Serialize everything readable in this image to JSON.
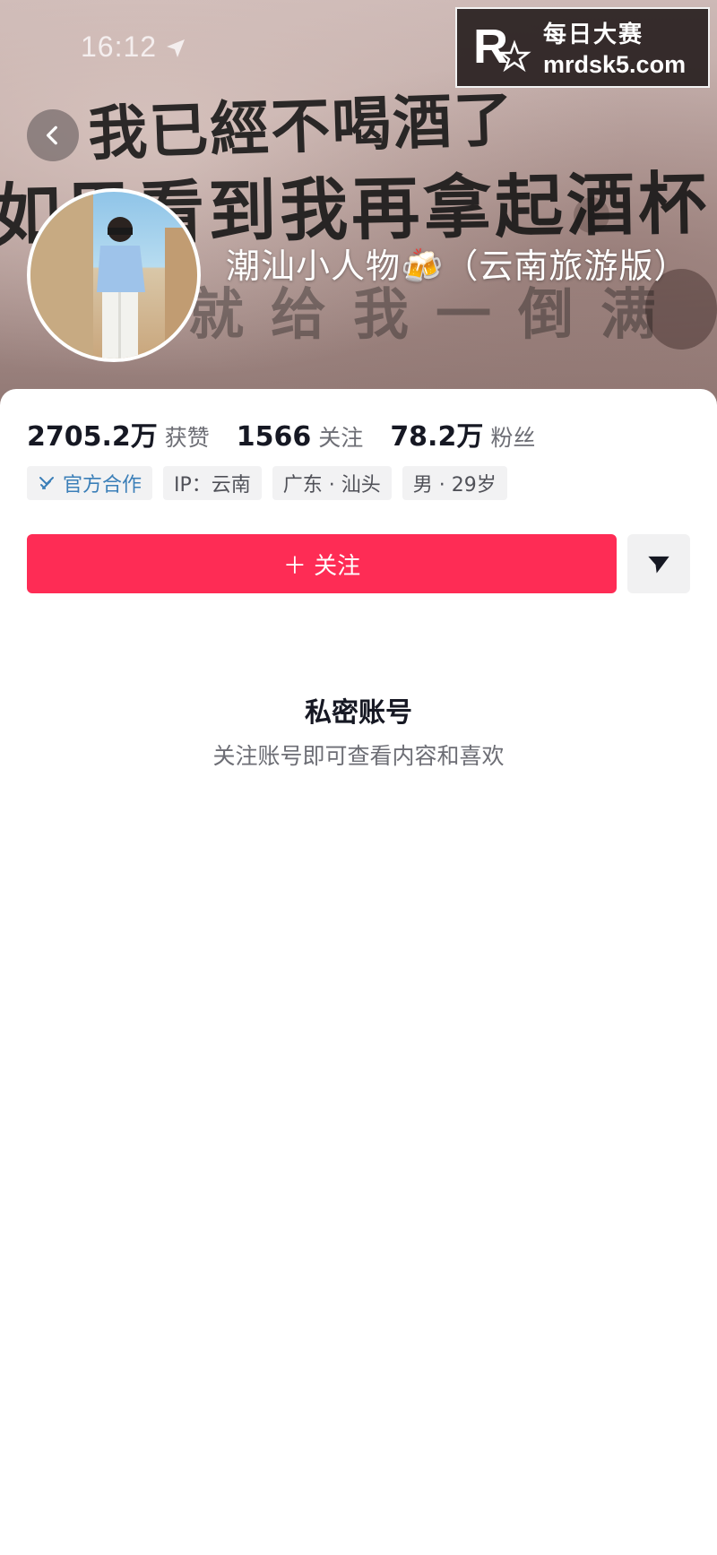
{
  "status_bar": {
    "time": "16:12"
  },
  "banner": {
    "scrawl_line1": "我已經不喝酒了",
    "scrawl_line2": "如果看到我再拿起酒杯",
    "scrawl_line3": "就给我一倒满"
  },
  "watermark": {
    "brand_cn": "每日大赛",
    "domain": "mrdsk5.com"
  },
  "profile": {
    "username": "潮汕小人物🍻（云南旅游版）",
    "stats": [
      {
        "value": "2705.2万",
        "label": "获赞"
      },
      {
        "value": "1566",
        "label": "关注"
      },
      {
        "value": "78.2万",
        "label": "粉丝"
      }
    ],
    "tags": [
      {
        "label": "官方合作",
        "icon": "official-cooperation-icon"
      },
      {
        "label": "IP：云南"
      },
      {
        "label": "广东 · 汕头"
      },
      {
        "label": "男 · 29岁"
      }
    ],
    "follow_label": "＋ 关注"
  },
  "private_notice": {
    "title": "私密账号",
    "subtitle": "关注账号即可查看内容和喜欢"
  },
  "colors": {
    "follow_button": "#fe2c55",
    "official_tag": "#3b7fb8"
  }
}
